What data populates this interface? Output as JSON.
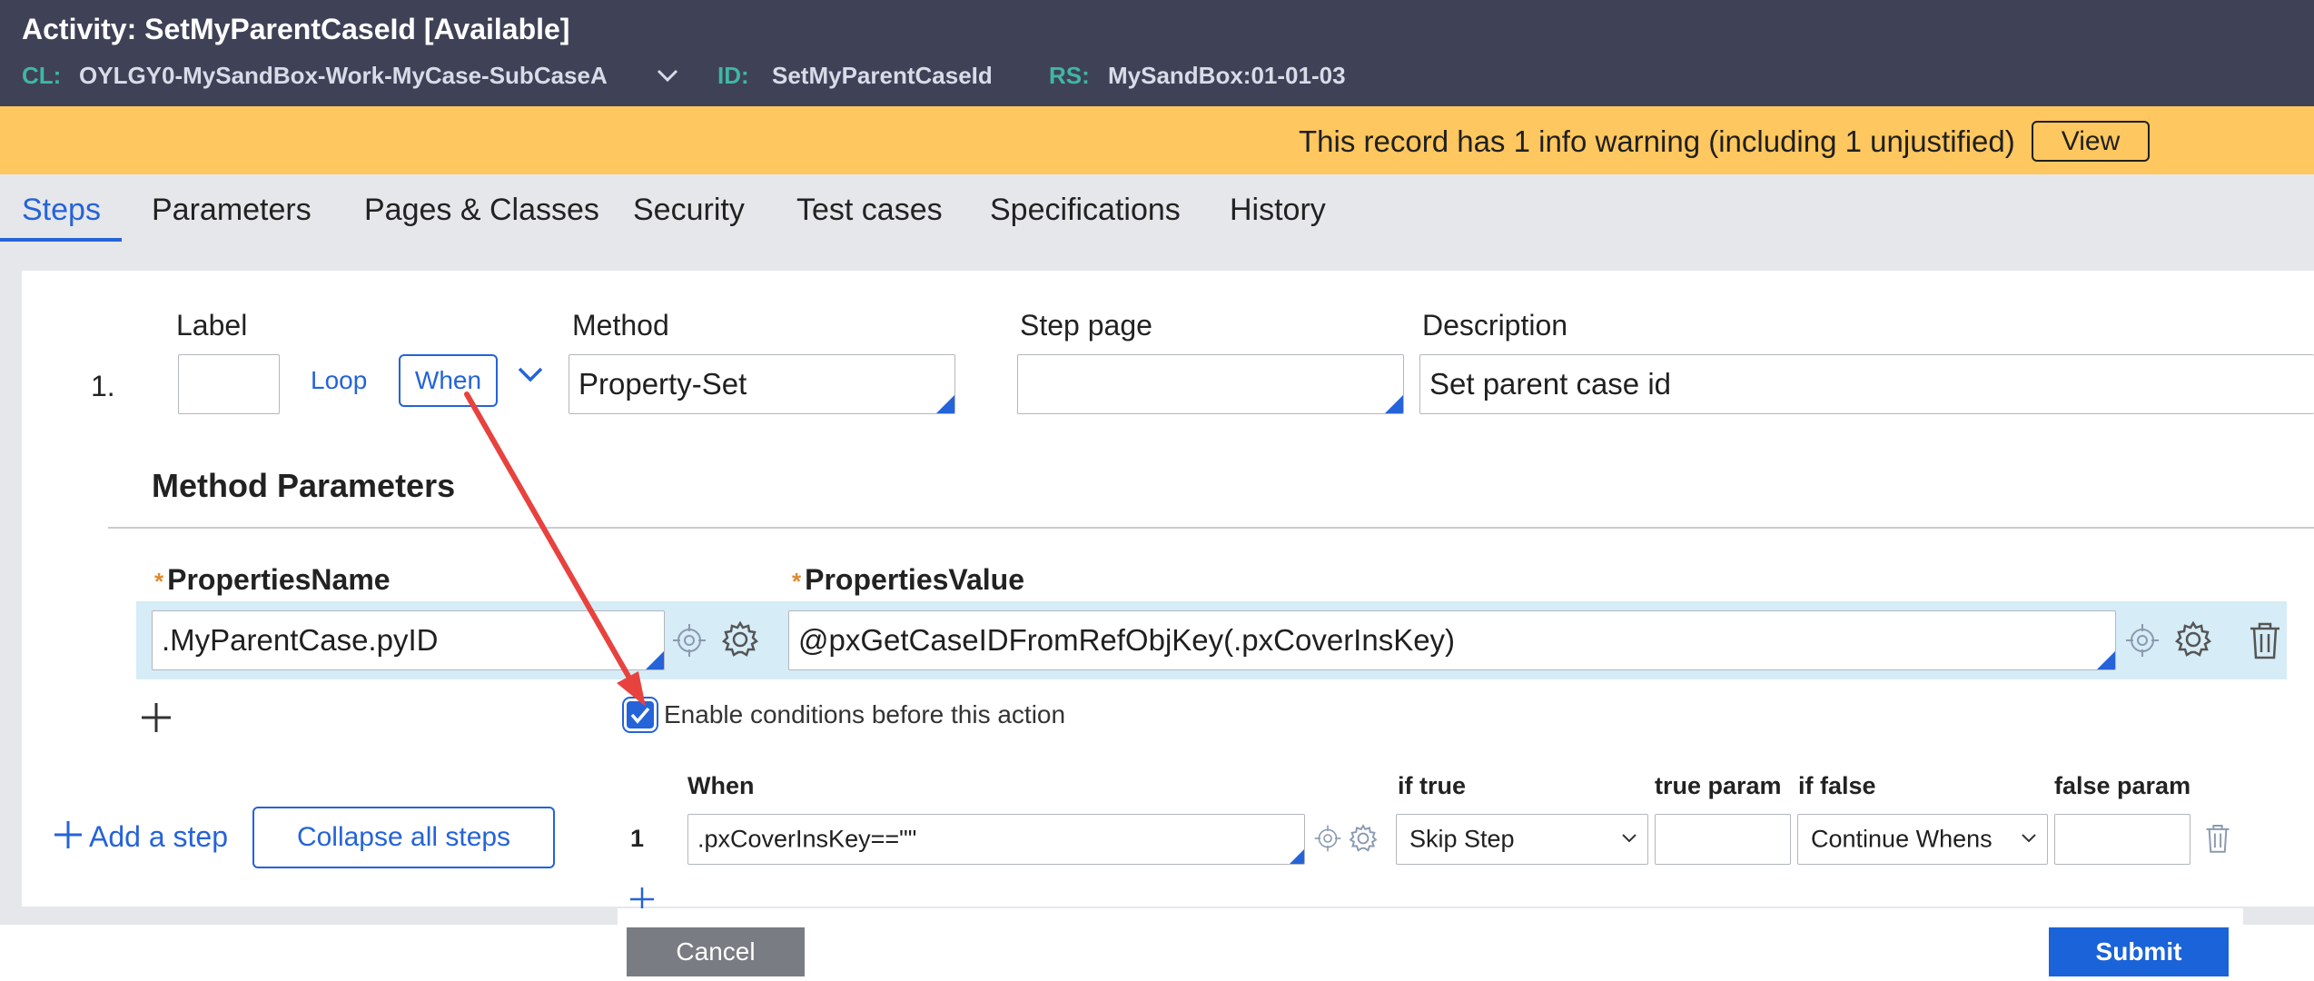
{
  "header": {
    "title": "Activity: SetMyParentCaseId [Available]",
    "cl_key": "CL:",
    "cl_value": "OYLGY0-MySandBox-Work-MyCase-SubCaseA",
    "id_key": "ID:",
    "id_value": "SetMyParentCaseId",
    "rs_key": "RS:",
    "rs_value": "MySandBox:01-01-03"
  },
  "warning": {
    "text": "This record has 1 info warning (including 1 unjustified)",
    "view_label": "View"
  },
  "tabs": [
    {
      "label": "Steps",
      "active": true
    },
    {
      "label": "Parameters"
    },
    {
      "label": "Pages & Classes"
    },
    {
      "label": "Security"
    },
    {
      "label": "Test cases"
    },
    {
      "label": "Specifications"
    },
    {
      "label": "History"
    }
  ],
  "step": {
    "columns": {
      "label": "Label",
      "method": "Method",
      "step_page": "Step page",
      "description": "Description"
    },
    "number": "1.",
    "label_value": "",
    "loop_label": "Loop",
    "when_label": "When",
    "method_value": "Property-Set",
    "step_page_value": "",
    "description_value": "Set parent case id"
  },
  "method_parameters": {
    "heading": "Method Parameters",
    "properties_name_label": "PropertiesName",
    "properties_value_label": "PropertiesValue",
    "required_marker": "*",
    "properties_name_value": ".MyParentCase.pyID",
    "properties_value_value": "@pxGetCaseIDFromRefObjKey(.pxCoverInsKey)"
  },
  "conditions": {
    "enable_label": "Enable conditions before this action",
    "enabled": true,
    "headers": {
      "when": "When",
      "if_true": "if true",
      "true_param": "true param",
      "if_false": "if false",
      "false_param": "false param"
    },
    "row": {
      "number": "1",
      "when": ".pxCoverInsKey==\"\"",
      "if_true": "Skip Step",
      "true_param": "",
      "if_false": "Continue Whens",
      "false_param": ""
    }
  },
  "actions": {
    "add_step": "Add a step",
    "collapse_all": "Collapse all steps",
    "cancel": "Cancel",
    "submit": "Submit"
  },
  "colors": {
    "header_bg": "#3f4256",
    "accent": "#2563d8",
    "warning_bg": "#fec75f",
    "meta_key": "#3fb7a4",
    "annotation_arrow": "#e8423f"
  },
  "icons": {
    "chevron": "chevron-down-icon",
    "target": "crosshair-icon",
    "gear": "gear-icon",
    "trash": "trash-icon",
    "plus": "plus-icon",
    "check": "checkmark-icon"
  }
}
